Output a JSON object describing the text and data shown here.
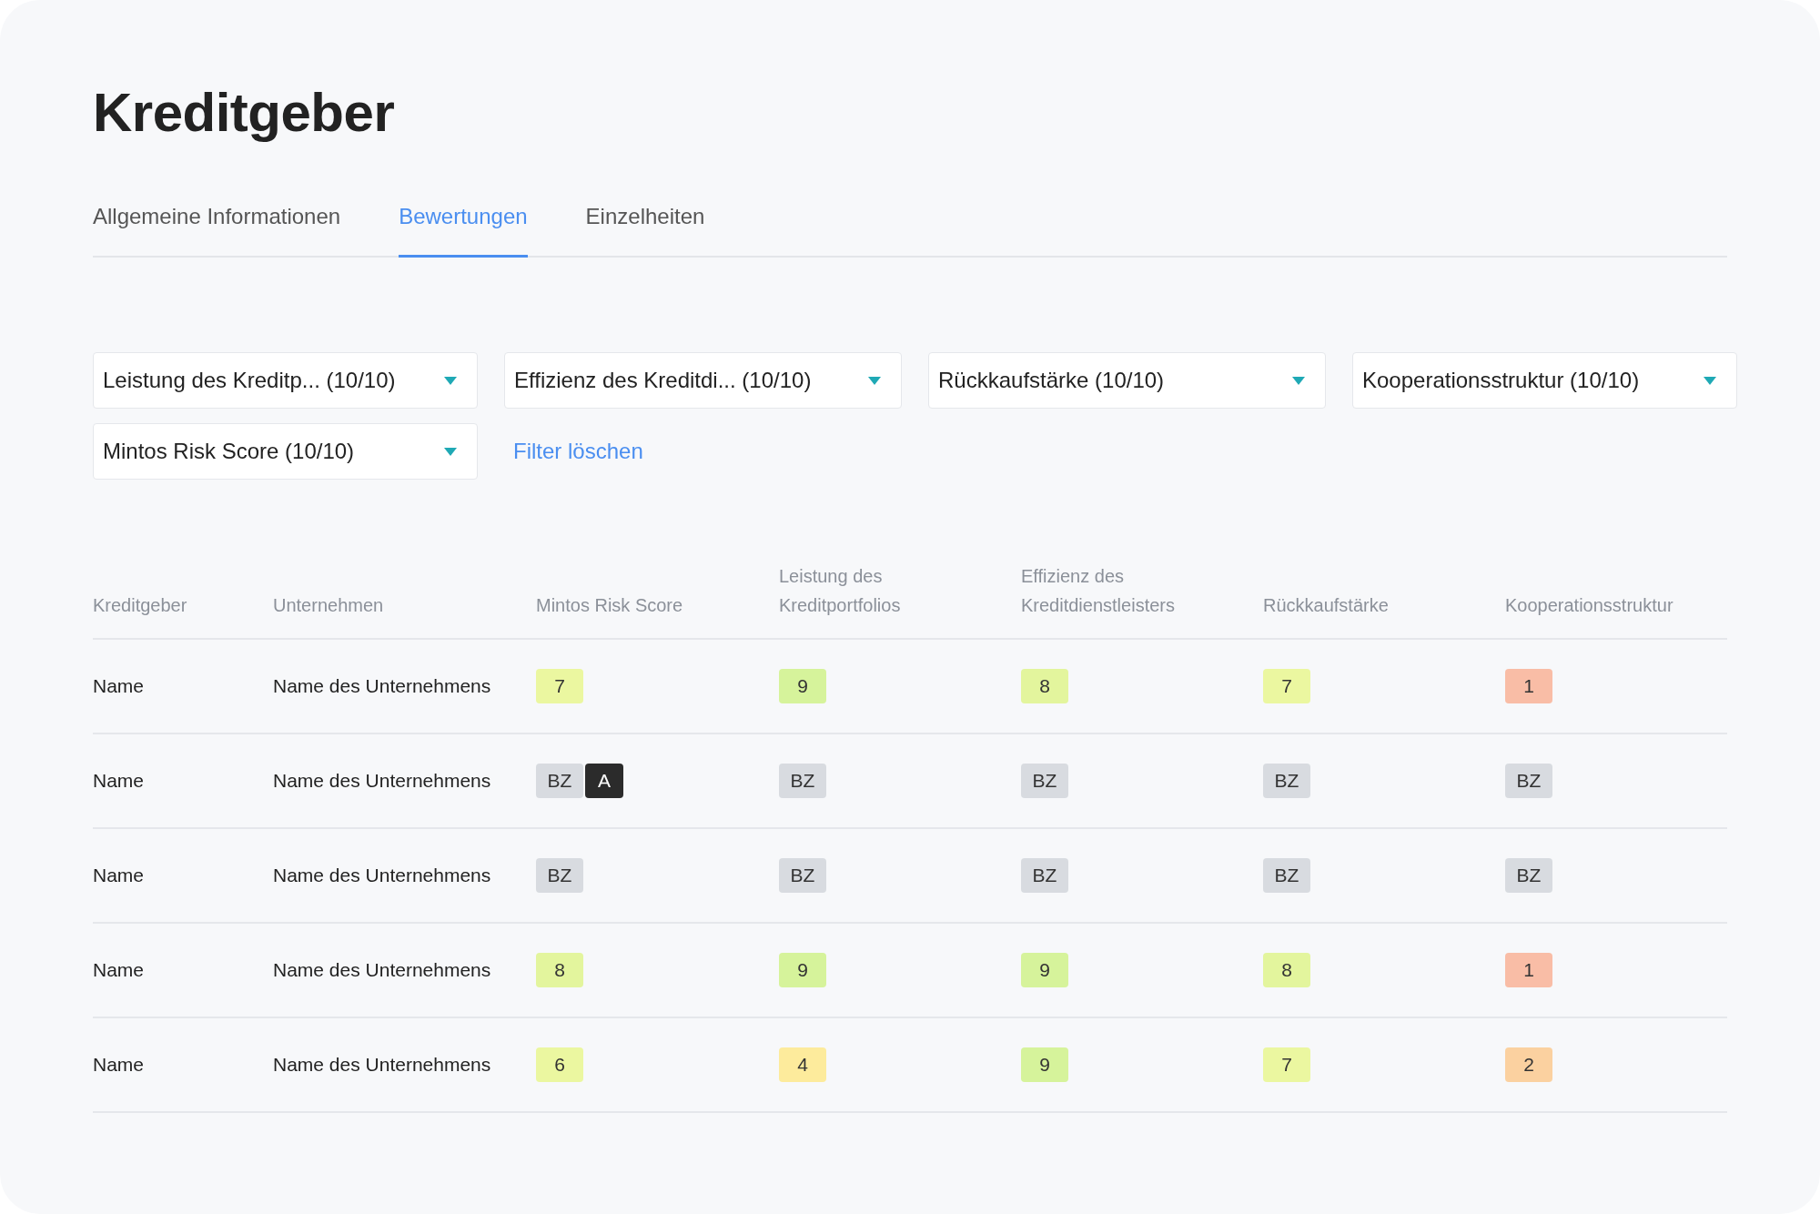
{
  "title": "Kreditgeber",
  "tabs": [
    {
      "label": "Allgemeine Informationen",
      "selected": false
    },
    {
      "label": "Bewertungen",
      "selected": true
    },
    {
      "label": "Einzelheiten",
      "selected": false
    }
  ],
  "filters": [
    {
      "label": "Leistung des Kreditp... (10/10)"
    },
    {
      "label": "Effizienz des Kreditdi... (10/10)"
    },
    {
      "label": "Rückkaufstärke (10/10)"
    },
    {
      "label": "Kooperationsstruktur (10/10)"
    },
    {
      "label": "Mintos Risk Score (10/10)"
    }
  ],
  "clear_filters": "Filter löschen",
  "table": {
    "columns": [
      "Kreditgeber",
      "Unternehmen",
      "Mintos Risk Score",
      "Leistung des Kreditportfolios",
      "Effizienz des Kreditdienstleisters",
      "Rückkaufstärke",
      "Kooperationsstruktur"
    ],
    "rows": [
      {
        "lender": "Name",
        "company": "Name des Unternehmens",
        "scores": [
          [
            {
              "kind": "score",
              "text": "7",
              "color": "#ebf7a0"
            }
          ],
          [
            {
              "kind": "score",
              "text": "9",
              "color": "#d6f39b"
            }
          ],
          [
            {
              "kind": "score",
              "text": "8",
              "color": "#e3f59d"
            }
          ],
          [
            {
              "kind": "score",
              "text": "7",
              "color": "#ebf7a0"
            }
          ],
          [
            {
              "kind": "score",
              "text": "1",
              "color": "#f9bda6"
            }
          ]
        ]
      },
      {
        "lender": "Name",
        "company": "Name des Unternehmens",
        "scores": [
          [
            {
              "kind": "neutral",
              "text": "BZ"
            },
            {
              "kind": "dark",
              "text": "A"
            }
          ],
          [
            {
              "kind": "neutral",
              "text": "BZ"
            }
          ],
          [
            {
              "kind": "neutral",
              "text": "BZ"
            }
          ],
          [
            {
              "kind": "neutral",
              "text": "BZ"
            }
          ],
          [
            {
              "kind": "neutral",
              "text": "BZ"
            }
          ]
        ]
      },
      {
        "lender": "Name",
        "company": "Name des Unternehmens",
        "scores": [
          [
            {
              "kind": "neutral",
              "text": "BZ"
            }
          ],
          [
            {
              "kind": "neutral",
              "text": "BZ"
            }
          ],
          [
            {
              "kind": "neutral",
              "text": "BZ"
            }
          ],
          [
            {
              "kind": "neutral",
              "text": "BZ"
            }
          ],
          [
            {
              "kind": "neutral",
              "text": "BZ"
            }
          ]
        ]
      },
      {
        "lender": "Name",
        "company": "Name des Unternehmens",
        "scores": [
          [
            {
              "kind": "score",
              "text": "8",
              "color": "#e3f59d"
            }
          ],
          [
            {
              "kind": "score",
              "text": "9",
              "color": "#d6f39b"
            }
          ],
          [
            {
              "kind": "score",
              "text": "9",
              "color": "#d6f39b"
            }
          ],
          [
            {
              "kind": "score",
              "text": "8",
              "color": "#e3f59d"
            }
          ],
          [
            {
              "kind": "score",
              "text": "1",
              "color": "#f9bda6"
            }
          ]
        ]
      },
      {
        "lender": "Name",
        "company": "Name des Unternehmens",
        "scores": [
          [
            {
              "kind": "score",
              "text": "6",
              "color": "#ebf7a0"
            }
          ],
          [
            {
              "kind": "score",
              "text": "4",
              "color": "#fdeb9c"
            }
          ],
          [
            {
              "kind": "score",
              "text": "9",
              "color": "#d6f39b"
            }
          ],
          [
            {
              "kind": "score",
              "text": "7",
              "color": "#ebf7a0"
            }
          ],
          [
            {
              "kind": "score",
              "text": "2",
              "color": "#fbd1a0"
            }
          ]
        ]
      }
    ]
  }
}
